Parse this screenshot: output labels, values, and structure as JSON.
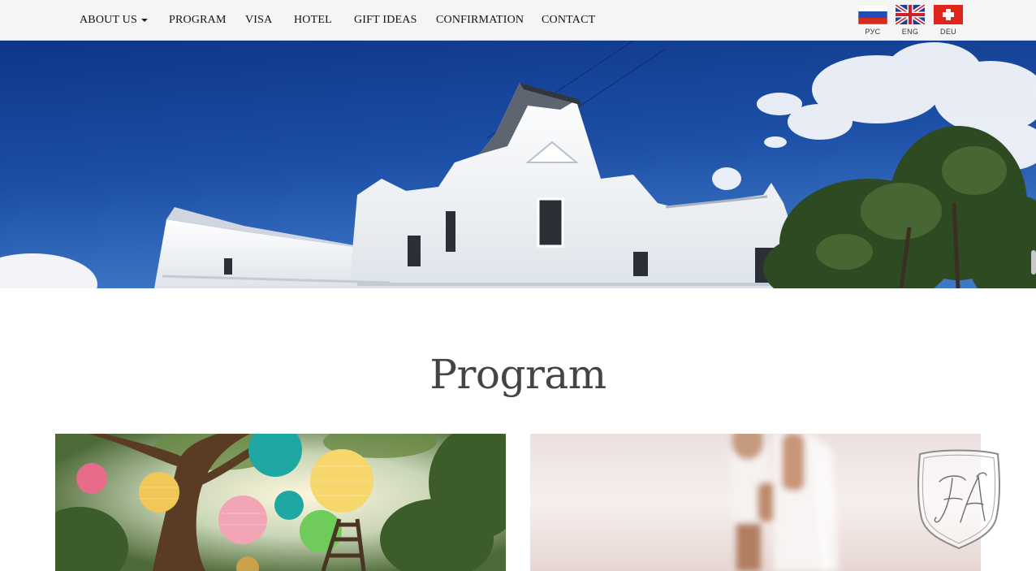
{
  "nav": {
    "items": [
      {
        "label": "ABOUT US",
        "has_dropdown": true
      },
      {
        "label": "PROGRAM"
      },
      {
        "label": "VISA"
      },
      {
        "label": "HOTEL"
      },
      {
        "label": "GIFT IDEAS"
      },
      {
        "label": "CONFIRMATION"
      },
      {
        "label": "CONTACT"
      }
    ]
  },
  "languages": [
    {
      "label": "РУС",
      "flag": "russia-flag"
    },
    {
      "label": "ENG",
      "flag": "uk-flag"
    },
    {
      "label": "DEU",
      "flag": "swiss-flag"
    }
  ],
  "hero": {
    "image": "white-manor-building-blue-sky-photo"
  },
  "section": {
    "title": "Program"
  },
  "cards": [
    {
      "image": "paper-lanterns-in-tree-photo"
    },
    {
      "image": "couple-holding-hands-photo"
    }
  ],
  "colors": {
    "navbar_bg": "#f5f5f5",
    "title_text": "#444444",
    "sky_blue": "#1c4fa6"
  }
}
